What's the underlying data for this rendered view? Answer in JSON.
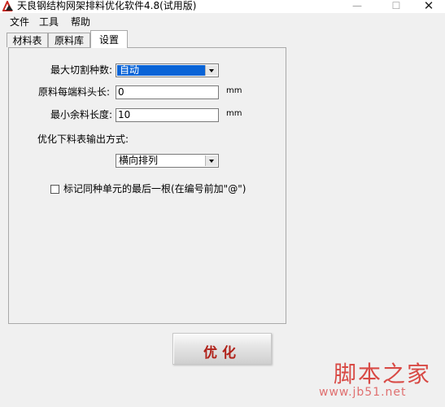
{
  "window": {
    "title": "天良钢结构网架排料优化软件4.8(试用版)",
    "minimize_glyph": "—",
    "maximize_glyph": "☐",
    "close_glyph": "✕"
  },
  "menu": {
    "file": "文件",
    "tools": "工具",
    "help": "帮助"
  },
  "tabs": [
    {
      "label": "材料表"
    },
    {
      "label": "原料库"
    },
    {
      "label": "设置",
      "active": true
    }
  ],
  "settings": {
    "max_cut_types_label": "最大切割种数:",
    "max_cut_types_value": "自动",
    "head_length_label": "原料每端料头长:",
    "head_length_value": "0",
    "head_length_unit": "mm",
    "min_remainder_label": "最小余料长度:",
    "min_remainder_value": "10",
    "min_remainder_unit": "mm",
    "output_mode_label": "优化下料表输出方式:",
    "output_mode_value": "横向排列",
    "mark_last_label": "标记同种单元的最后一根(在编号前加\"@\")",
    "mark_last_checked": false
  },
  "actions": {
    "optimize_label": "优化"
  },
  "watermark": {
    "title": "脚本之家",
    "url": "www.jb51.net"
  },
  "colors": {
    "accent": "#0a64d7",
    "button_text": "#b0221a",
    "watermark": "#d84a45"
  }
}
